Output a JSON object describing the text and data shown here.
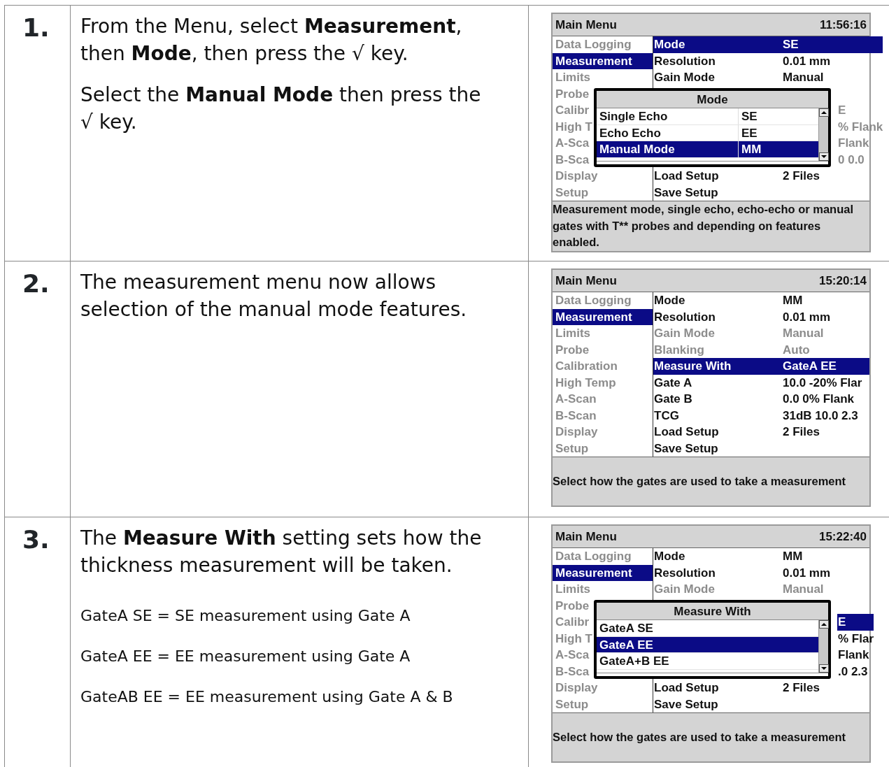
{
  "steps": [
    {
      "number": "1.",
      "paragraphs": [
        {
          "kind": "main",
          "text": "From the Menu, select **Measurement**, then **Mode**, then press the √ key."
        },
        {
          "kind": "main",
          "text": "Select the **Manual Mode** then press the √ key."
        }
      ],
      "screen": {
        "title": "Main Menu",
        "time": "11:56:16",
        "menu": [
          {
            "label": "Data Logging",
            "selected": false
          },
          {
            "label": "Measurement",
            "selected": true
          },
          {
            "label": "Limits",
            "selected": false
          },
          {
            "label": "Probe",
            "selected": false
          },
          {
            "label": "Calibr",
            "selected": false
          },
          {
            "label": "High T",
            "selected": false
          },
          {
            "label": "A-Sca",
            "selected": false
          },
          {
            "label": "B-Sca",
            "selected": false
          },
          {
            "label": "Display",
            "selected": false
          },
          {
            "label": "Setup",
            "selected": false
          }
        ],
        "rows": [
          {
            "kind": "full",
            "label": "Mode",
            "value": "SE",
            "selected": true,
            "disabled": false
          },
          {
            "kind": "full",
            "label": "Resolution",
            "value": "0.01 mm",
            "selected": false,
            "disabled": false
          },
          {
            "kind": "full",
            "label": "Gain Mode",
            "value": "Manual",
            "selected": false,
            "disabled": false
          },
          {
            "kind": "covered"
          },
          {
            "kind": "covered",
            "value": "E",
            "selected": false,
            "disabled": true
          },
          {
            "kind": "covered",
            "value": "% Flank",
            "selected": false,
            "disabled": true
          },
          {
            "kind": "covered",
            "value": "Flank",
            "selected": false,
            "disabled": true
          },
          {
            "kind": "covered",
            "value": "0 0.0",
            "selected": false,
            "disabled": true
          },
          {
            "kind": "full",
            "label": "Load Setup",
            "value": "2 Files",
            "selected": false,
            "disabled": false
          },
          {
            "kind": "full",
            "label": "Save Setup",
            "selected": false,
            "disabled": false
          }
        ],
        "popup": {
          "title": "Mode",
          "options": [
            {
              "label": "Single Echo",
              "code": "SE",
              "selected": false
            },
            {
              "label": "Echo Echo",
              "code": "EE",
              "selected": false
            },
            {
              "label": "Manual Mode",
              "code": "MM",
              "selected": true
            }
          ]
        },
        "footer": "Measurement mode, single echo, echo-echo or manual gates with T** probes and depending on features enabled."
      }
    },
    {
      "number": "2.",
      "paragraphs": [
        {
          "kind": "main",
          "text": "The measurement menu now allows selection of the manual mode features."
        }
      ],
      "screen": {
        "title": "Main Menu",
        "time": "15:20:14",
        "menu": [
          {
            "label": "Data Logging",
            "selected": false
          },
          {
            "label": "Measurement",
            "selected": true
          },
          {
            "label": "Limits",
            "selected": false
          },
          {
            "label": "Probe",
            "selected": false
          },
          {
            "label": "Calibration",
            "selected": false
          },
          {
            "label": "High Temp",
            "selected": false
          },
          {
            "label": "A-Scan",
            "selected": false
          },
          {
            "label": "B-Scan",
            "selected": false
          },
          {
            "label": "Display",
            "selected": false
          },
          {
            "label": "Setup",
            "selected": false
          }
        ],
        "rows": [
          {
            "kind": "full",
            "label": "Mode",
            "value": "MM",
            "selected": false,
            "disabled": false
          },
          {
            "kind": "full",
            "label": "Resolution",
            "value": "0.01 mm",
            "selected": false,
            "disabled": false
          },
          {
            "kind": "full",
            "label": "Gain Mode",
            "value": "Manual",
            "selected": false,
            "disabled": true
          },
          {
            "kind": "full",
            "label": "Blanking",
            "value": "Auto",
            "selected": false,
            "disabled": true
          },
          {
            "kind": "full",
            "label": "Measure With",
            "value": "GateA EE",
            "selected": true,
            "disabled": false
          },
          {
            "kind": "full",
            "label": "Gate A",
            "value": "10.0 -20% Flar",
            "selected": false,
            "disabled": false
          },
          {
            "kind": "full",
            "label": "Gate B",
            "value": "0.0 0% Flank",
            "selected": false,
            "disabled": false
          },
          {
            "kind": "full",
            "label": "TCG",
            "value": "31dB 10.0  2.3",
            "selected": false,
            "disabled": false
          },
          {
            "kind": "full",
            "label": "Load Setup",
            "value": "2 Files",
            "selected": false,
            "disabled": false
          },
          {
            "kind": "full",
            "label": "Save Setup",
            "selected": false,
            "disabled": false
          }
        ],
        "footer": "Select how the gates are used to take a measurement"
      }
    },
    {
      "number": "3.",
      "paragraphs": [
        {
          "kind": "main",
          "text": "The **Measure With** setting sets how the thickness measurement will be taken."
        },
        {
          "kind": "detail",
          "text": "GateA SE = SE measurement using Gate A"
        },
        {
          "kind": "detail",
          "text": "GateA EE = EE measurement using Gate A"
        },
        {
          "kind": "detail",
          "text": "GateAB EE = EE measurement using Gate A & B"
        }
      ],
      "screen": {
        "title": "Main Menu",
        "time": "15:22:40",
        "menu": [
          {
            "label": "Data Logging",
            "selected": false
          },
          {
            "label": "Measurement",
            "selected": true
          },
          {
            "label": "Limits",
            "selected": false
          },
          {
            "label": "Probe",
            "selected": false
          },
          {
            "label": "Calibr",
            "selected": false
          },
          {
            "label": "High T",
            "selected": false
          },
          {
            "label": "A-Sca",
            "selected": false
          },
          {
            "label": "B-Sca",
            "selected": false
          },
          {
            "label": "Display",
            "selected": false
          },
          {
            "label": "Setup",
            "selected": false
          }
        ],
        "rows": [
          {
            "kind": "full",
            "label": "Mode",
            "value": "MM",
            "selected": false,
            "disabled": false
          },
          {
            "kind": "full",
            "label": "Resolution",
            "value": "0.01 mm",
            "selected": false,
            "disabled": false
          },
          {
            "kind": "full",
            "label": "Gain Mode",
            "value": "Manual",
            "selected": false,
            "disabled": true
          },
          {
            "kind": "covered"
          },
          {
            "kind": "covered",
            "value": "E",
            "selected": true,
            "disabled": false
          },
          {
            "kind": "covered",
            "value": "% Flar",
            "selected": false,
            "disabled": false
          },
          {
            "kind": "covered",
            "value": "Flank",
            "selected": false,
            "disabled": false
          },
          {
            "kind": "covered",
            "value": ".0  2.3",
            "selected": false,
            "disabled": false
          },
          {
            "kind": "full",
            "label": "Load Setup",
            "value": "2 Files",
            "selected": false,
            "disabled": false
          },
          {
            "kind": "full",
            "label": "Save Setup",
            "selected": false,
            "disabled": false
          }
        ],
        "popup": {
          "title": "Measure With",
          "options": [
            {
              "label": "GateA SE",
              "selected": false
            },
            {
              "label": "GateA EE",
              "selected": true
            },
            {
              "label": "GateA+B EE",
              "selected": false
            }
          ]
        },
        "footer": "Select how the gates are used to take a measurement"
      }
    }
  ]
}
